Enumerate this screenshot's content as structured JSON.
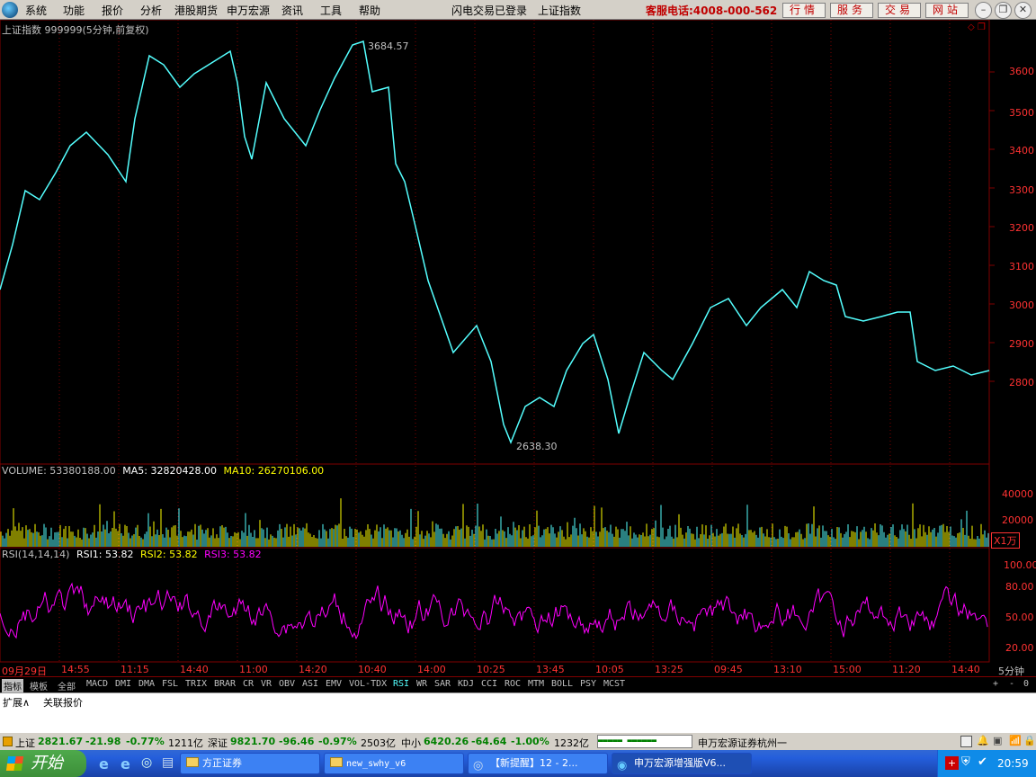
{
  "menu": [
    "系统",
    "功能",
    "报价",
    "分析",
    "港股期货",
    "申万宏源",
    "资讯",
    "工具",
    "帮助"
  ],
  "login_status": "闪电交易已登录",
  "current_index": "上证指数",
  "hotline": "客服电话:4008-000-562",
  "top_buttons": [
    "行情",
    "服务",
    "交易",
    "网站"
  ],
  "chart": {
    "title": "上证指数 999999(5分钟,前复权)",
    "high_label": "3684.57",
    "low_label": "2638.30",
    "y_ticks": [
      "3600",
      "3500",
      "3400",
      "3300",
      "3200",
      "3100",
      "3000",
      "2900",
      "2800"
    ]
  },
  "volume": {
    "prefix": "VOLUME:",
    "value": "53380188.00",
    "ma5_label": "MA5:",
    "ma5_value": "32820428.00",
    "ma10_label": "MA10:",
    "ma10_value": "26270106.00",
    "y_ticks": [
      "40000",
      "20000"
    ],
    "unit": "X1万"
  },
  "rsi": {
    "params": "RSI(14,14,14)",
    "rsi1_label": "RSI1:",
    "rsi1_value": "53.82",
    "rsi2_label": "RSI2:",
    "rsi2_value": "53.82",
    "rsi3_label": "RSI3:",
    "rsi3_value": "53.82",
    "y_ticks": [
      "100.00",
      "80.00",
      "50.00",
      "20.00"
    ]
  },
  "x_axis": {
    "labels": [
      "09月29日",
      "14:55",
      "11:15",
      "14:40",
      "11:00",
      "14:20",
      "10:40",
      "14:00",
      "10:25",
      "13:45",
      "10:05",
      "13:25",
      "09:45",
      "13:10",
      "15:00",
      "11:20",
      "14:40"
    ],
    "period": "5分钟"
  },
  "indicator_tabs": [
    "指标",
    "模板",
    "全部",
    "MACD",
    "DMI",
    "DMA",
    "FSL",
    "TRIX",
    "BRAR",
    "CR",
    "VR",
    "OBV",
    "ASI",
    "EMV",
    "VOL-TDX",
    "RSI",
    "WR",
    "SAR",
    "KDJ",
    "CCI",
    "ROC",
    "MTM",
    "BOLL",
    "PSY",
    "MCST"
  ],
  "active_indicator": "RSI",
  "nav_controls": [
    "+",
    "-",
    "0"
  ],
  "extend_tabs": [
    "扩展∧",
    "关联报价"
  ],
  "status": {
    "sh_name": "上证",
    "sh_value": "2821.67",
    "sh_change": "-21.98",
    "sh_pct": "-0.77%",
    "sh_amount": "1211亿",
    "sz_name": "深证",
    "sz_value": "9821.70",
    "sz_change": "-96.46",
    "sz_pct": "-0.97%",
    "sz_amount": "2503亿",
    "zx_name": "中小",
    "zx_value": "6420.26",
    "zx_change": "-64.64",
    "zx_pct": "-1.00%",
    "zx_amount": "1232亿",
    "broker": "申万宏源证券杭州一"
  },
  "taskbar": {
    "start": "开始",
    "tasks": [
      "方正证券",
      "new_swhy_v6",
      "【新提醒】12 - 2...",
      "申万宏源增强版V6..."
    ],
    "clock": "20:59"
  },
  "colors": {
    "up": "#ff3232",
    "down": "#54ffff",
    "rsi": "#ff00ff",
    "ma5": "#ffffff",
    "ma10": "#ffff00",
    "grid": "#800000"
  }
}
